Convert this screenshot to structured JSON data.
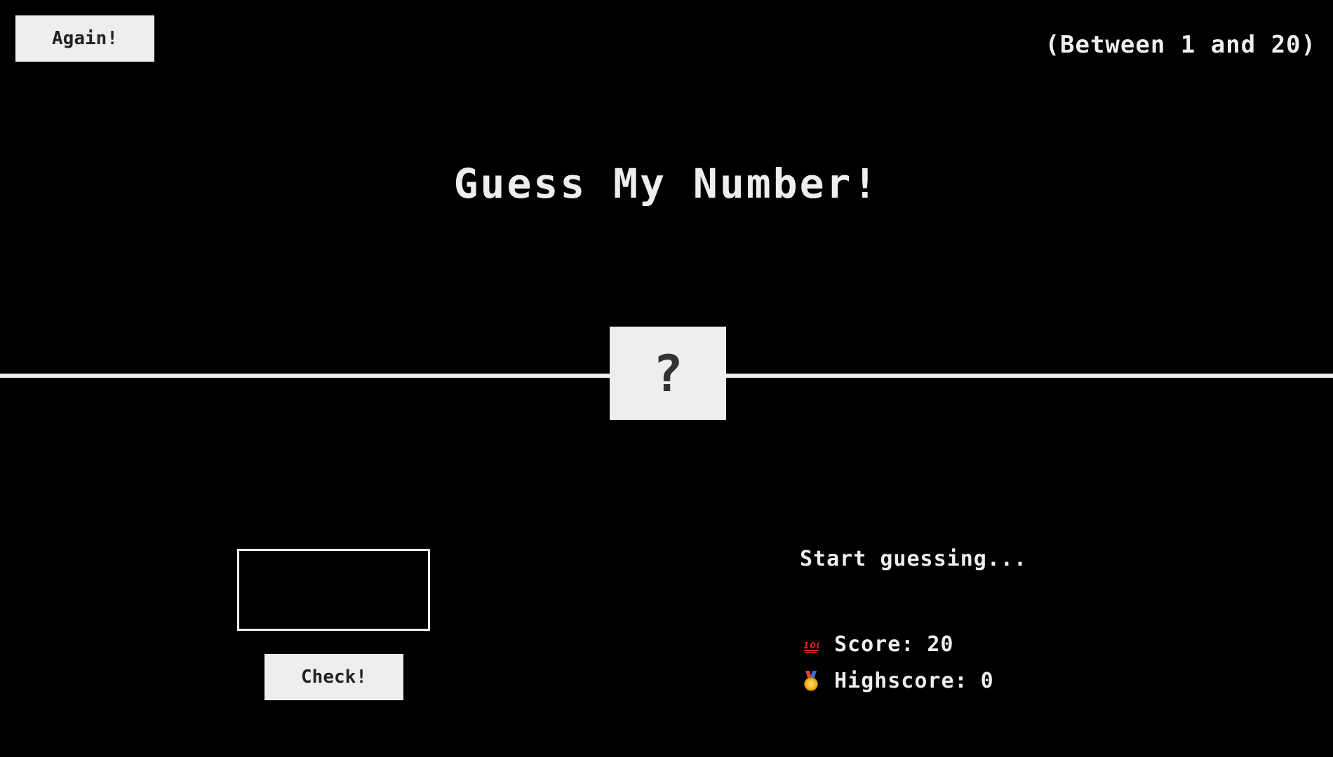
{
  "header": {
    "again_label": "Again!",
    "range_text": "(Between 1 and 20)"
  },
  "title": "Guess My Number!",
  "secret_number": "?",
  "left": {
    "guess_value": "",
    "check_label": "Check!"
  },
  "right": {
    "message": "Start guessing...",
    "score_label": "Score:",
    "score_value": "20",
    "highscore_label": "Highscore:",
    "highscore_value": "0",
    "score_icon": "hundred-points-icon",
    "highscore_icon": "medal-icon"
  },
  "colors": {
    "background": "#000000",
    "foreground": "#eeeeee",
    "button_text": "#222222",
    "number_text": "#333333"
  }
}
